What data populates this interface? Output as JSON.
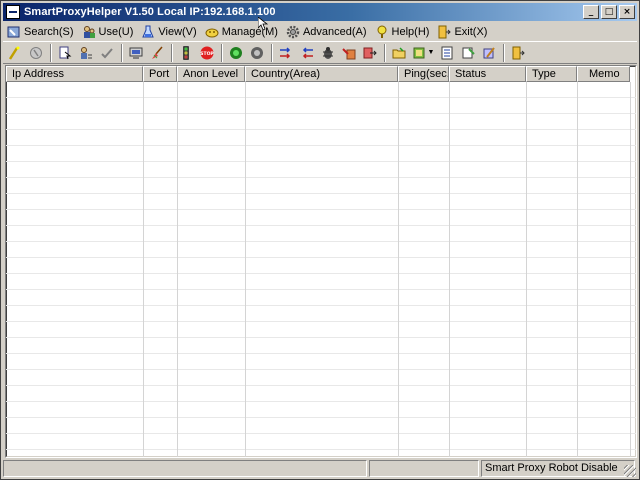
{
  "window": {
    "title": "SmartProxyHelper V1.50  Local IP:192.168.1.100",
    "buttons": [
      "_",
      "□",
      "×"
    ]
  },
  "menu": [
    {
      "label": "Search(S)",
      "icon": "search-icon"
    },
    {
      "label": "Use(U)",
      "icon": "users-icon"
    },
    {
      "label": "View(V)",
      "icon": "flask-icon"
    },
    {
      "label": "Manage(M)",
      "icon": "manage-icon"
    },
    {
      "label": "Advanced(A)",
      "icon": "gear-icon"
    },
    {
      "label": "Help(H)",
      "icon": "help-icon"
    },
    {
      "label": "Exit(X)",
      "icon": "exit-icon"
    }
  ],
  "toolbar": {
    "icons": [
      "wand-icon",
      "disabled-icon",
      "doc-pointer-icon",
      "user-edit-icon",
      "check-icon",
      "monitor-icon",
      "broom-icon",
      "traffic-light-icon",
      "stop-icon",
      "green-circle-icon",
      "gray-circle-icon",
      "arrows-right-icon",
      "arrows-left-icon",
      "bug-icon",
      "import-icon",
      "export-icon",
      "folder-icon",
      "chip-icon",
      "list-icon",
      "save-icon",
      "tools-icon",
      "exit-icon"
    ]
  },
  "table": {
    "columns": [
      "Ip Address",
      "Port",
      "Anon Level",
      "Country(Area)",
      "Ping(sec.)",
      "Status",
      "Type",
      "Memo"
    ],
    "rows": []
  },
  "statusbar": {
    "panel1": "",
    "panel2": "",
    "panel3": "Smart Proxy Robot Disable"
  }
}
